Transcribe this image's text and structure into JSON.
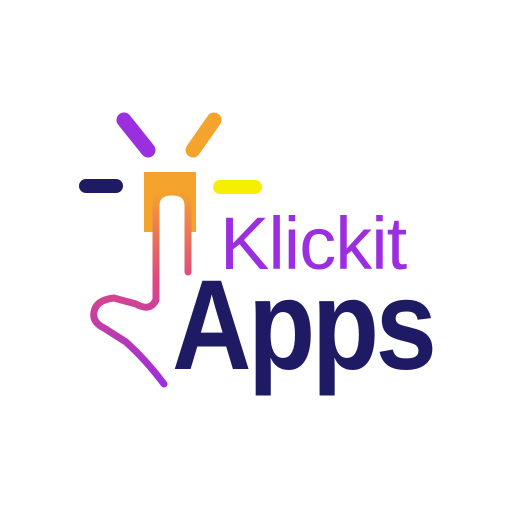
{
  "brand": {
    "name_top": "Klickit",
    "name_bottom": "Apps"
  },
  "icons": {
    "mark": "tap-finger-icon",
    "rays": "click-rays-icon"
  },
  "colors": {
    "background": "#ffffff",
    "purple": "#9b2fe0",
    "navy": "#1e1b64",
    "orange": "#f4a32c",
    "yellow": "#f6f000",
    "ray_purple": "#9b2fe0",
    "ray_orange": "#f4a32c",
    "ray_navy": "#1e1b64",
    "ray_yellow": "#f6f000"
  }
}
